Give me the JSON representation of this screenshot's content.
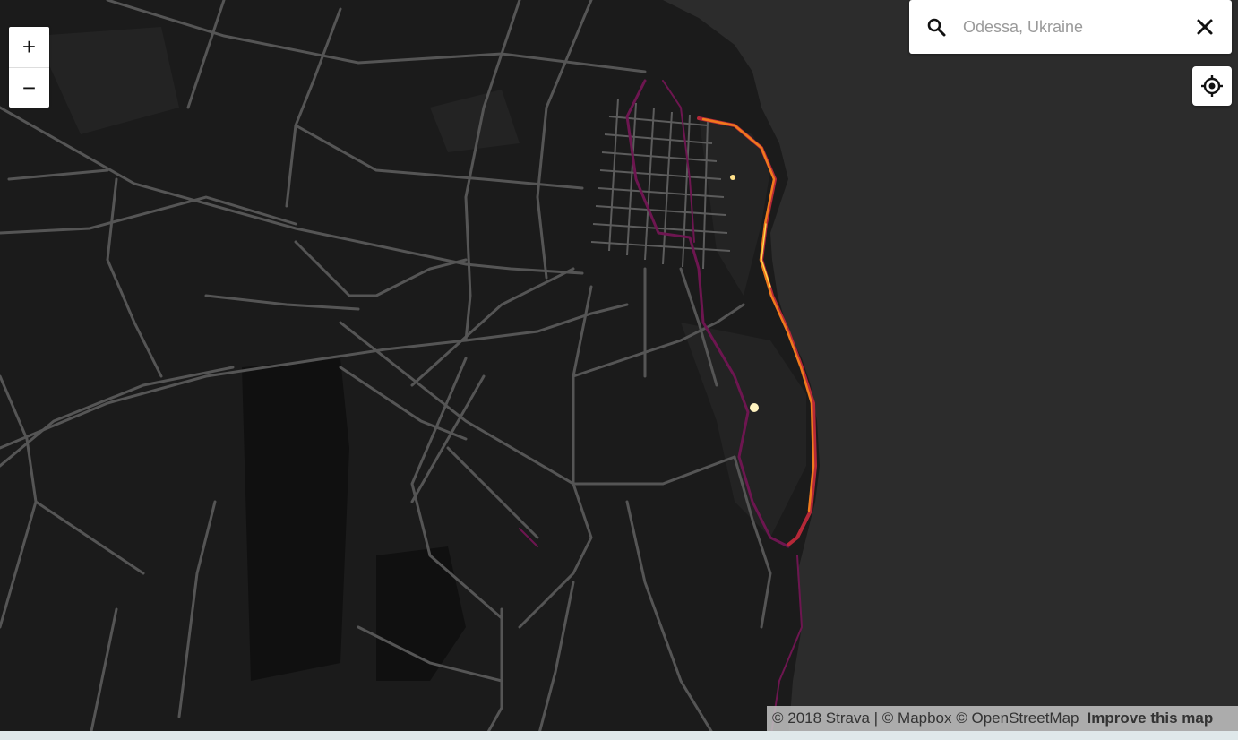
{
  "zoom": {
    "in_label": "+",
    "out_label": "−"
  },
  "search": {
    "placeholder": "Odessa, Ukraine",
    "value": "",
    "icon": "search-icon",
    "clear_icon": "close-icon"
  },
  "locate": {
    "icon": "crosshair-location-icon"
  },
  "attribution": {
    "text": "© 2018 Strava | © Mapbox © OpenStreetMap",
    "improve_label": "Improve this map"
  },
  "map": {
    "city": "Odessa, Ukraine",
    "colors": {
      "land": "#1b1b1b",
      "sea": "#2c2c2c",
      "roads": "#5c5c5c",
      "heat_low": "#7a1a5a",
      "heat_mid": "#e0451e",
      "heat_high": "#ffd84a"
    }
  }
}
